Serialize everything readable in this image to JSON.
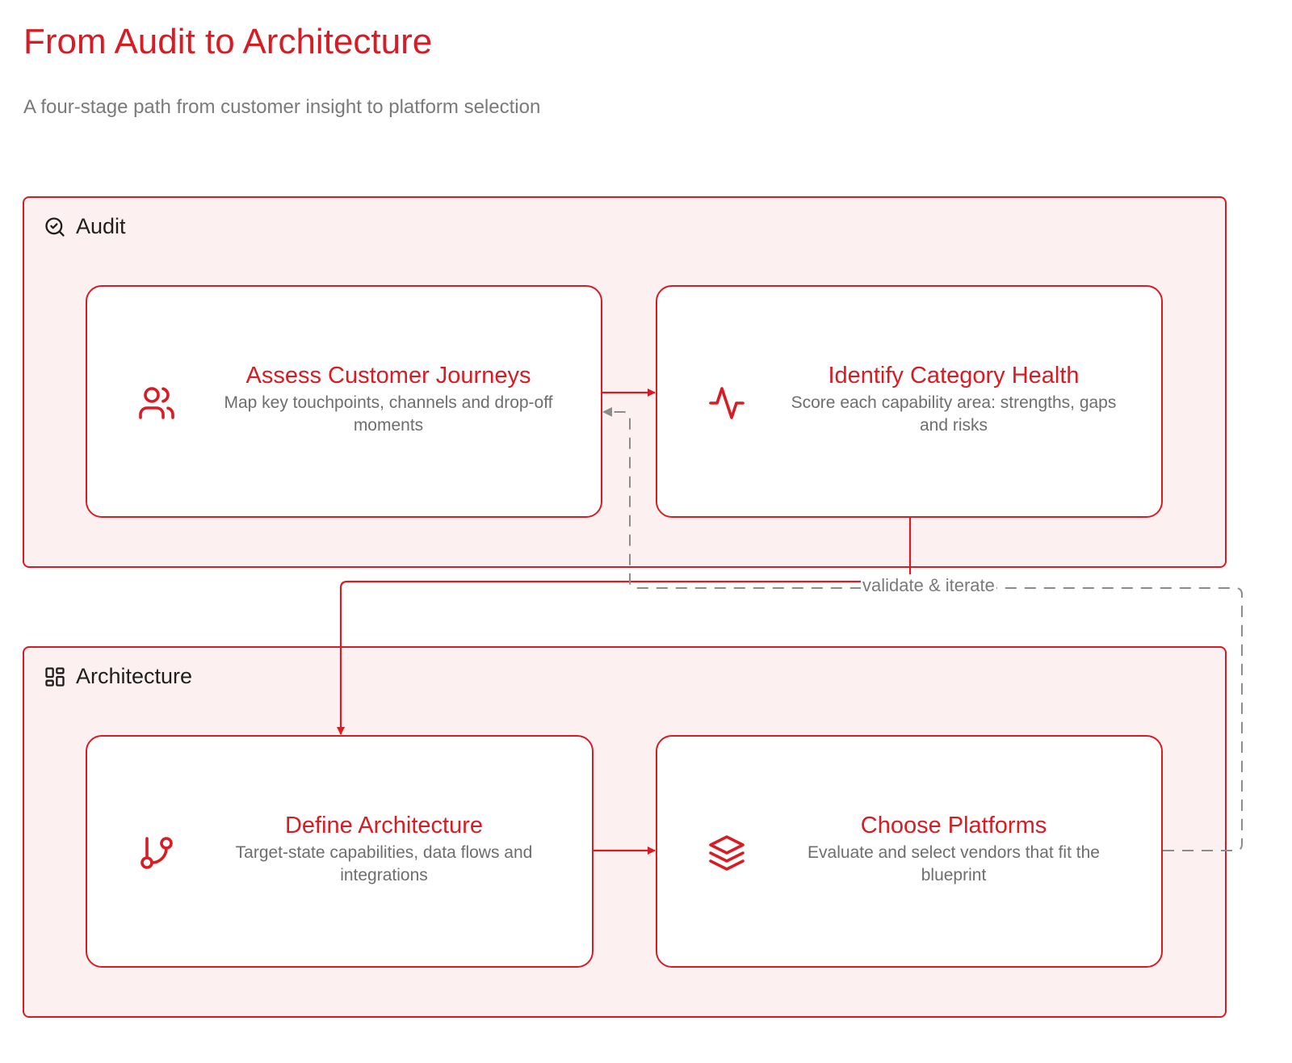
{
  "title": "From Audit to Architecture",
  "subtitle": "A four-stage path from customer insight to platform selection",
  "colors": {
    "accent": "#d71c24",
    "group_fill": "#fdf0f0",
    "muted_text": "#6e6e6e",
    "dashed_edge": "#8c8c8c"
  },
  "groups": [
    {
      "label": "Audit",
      "icon": "search-check-icon",
      "nodes": [
        {
          "title": "Assess Customer Journeys",
          "description": "Map key touchpoints, channels and drop-off moments",
          "icon": "users-icon"
        },
        {
          "title": "Identify Category Health",
          "description": "Score each capability area: strengths, gaps and risks",
          "icon": "activity-pulse-icon"
        }
      ]
    },
    {
      "label": "Architecture",
      "icon": "layout-grid-icon",
      "nodes": [
        {
          "title": "Define Architecture",
          "description": "Target-state capabilities, data flows and integrations",
          "icon": "git-branch-icon"
        },
        {
          "title": "Choose Platforms",
          "description": "Evaluate and select vendors that fit the blueprint",
          "icon": "layers-icon"
        }
      ]
    }
  ],
  "edges": {
    "feedback_label": "validate & iterate"
  }
}
